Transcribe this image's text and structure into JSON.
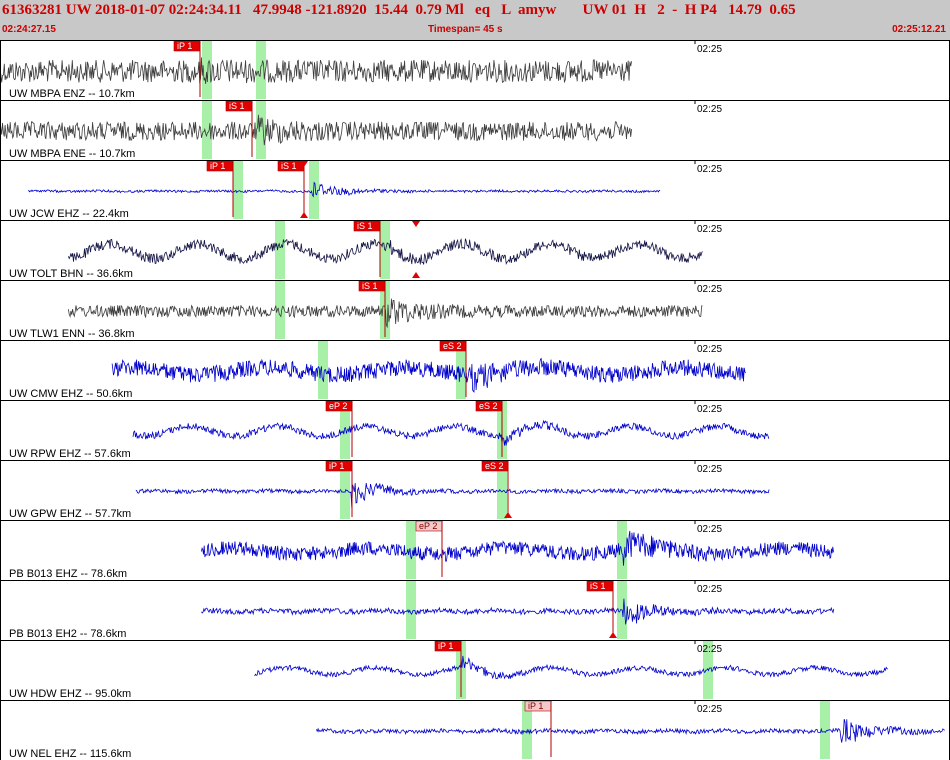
{
  "header": {
    "event_line": "61363281 UW 2018-01-07 02:24:34.11   47.9948 -121.8920  15.44  0.79 Ml   eq   L  amyw       UW 01  H   2  -  H P4   14.79  0.65",
    "start_time": "02:24:27.15",
    "timespan": "Timespan=  45 s",
    "end_time": "02:25:12.21"
  },
  "colors": {
    "header_bg": "#c8c8c8",
    "header_text": "#cc0000",
    "trace_gray": "#3c3c3c",
    "trace_blue": "#0000cc",
    "pick_fill": "#e00000",
    "pick_fill_light": "#f4c8c8",
    "window_green": "#a8f0a8",
    "border": "#000000"
  },
  "tick_label": "02:25",
  "channels": [
    {
      "label": "UW MBPA ENZ -- 10.7km",
      "color": "gray",
      "style": "noise",
      "start": 0.0,
      "end": 0.665,
      "amp": 0.42,
      "arrival": 0.21,
      "boost": 1.3,
      "picks": [
        {
          "text": "iP 1",
          "x": 0.21,
          "weight": "full",
          "marker": "none"
        }
      ],
      "windows": [
        0.218,
        0.275
      ]
    },
    {
      "label": "UW MBPA ENE -- 10.7km",
      "color": "gray",
      "style": "noise",
      "start": 0.0,
      "end": 0.665,
      "amp": 0.35,
      "arrival": 0.27,
      "boost": 1.8,
      "picks": [
        {
          "text": "iS 1",
          "x": 0.265,
          "weight": "full",
          "marker": "none"
        }
      ],
      "windows": [
        0.218,
        0.275
      ]
    },
    {
      "label": "UW JCW EHZ -- 22.4km",
      "color": "blue",
      "style": "quiet",
      "start": 0.03,
      "end": 0.695,
      "amp": 0.06,
      "arrival": 0.325,
      "boost": 9.0,
      "picks": [
        {
          "text": "iP 1",
          "x": 0.245,
          "weight": "full",
          "marker": "none"
        },
        {
          "text": "iS 1",
          "x": 0.32,
          "weight": "full",
          "marker": "tri"
        }
      ],
      "windows": [
        0.25,
        0.33
      ]
    },
    {
      "label": "UW TOLT BHN -- 36.6km",
      "color": "dark",
      "style": "wave",
      "start": 0.072,
      "end": 0.74,
      "amp": 0.42,
      "arrival": 0.405,
      "boost": 1.5,
      "picks": [
        {
          "text": "iS 1",
          "x": 0.4,
          "weight": "full",
          "marker": "tri2"
        }
      ],
      "windows": [
        0.295,
        0.405
      ]
    },
    {
      "label": "UW TLW1 ENN -- 36.8km",
      "color": "gray",
      "style": "noise",
      "start": 0.072,
      "end": 0.74,
      "amp": 0.22,
      "arrival": 0.405,
      "boost": 3.0,
      "picks": [
        {
          "text": "iS 1",
          "x": 0.405,
          "weight": "full",
          "marker": "none"
        }
      ],
      "windows": [
        0.295,
        0.405
      ]
    },
    {
      "label": "UW CMW EHZ -- 50.6km",
      "color": "blue",
      "style": "dense",
      "start": 0.118,
      "end": 0.785,
      "amp": 0.38,
      "arrival": 0.495,
      "boost": 1.9,
      "picks": [
        {
          "text": "eS 2",
          "x": 0.49,
          "weight": "full",
          "marker": "none"
        }
      ],
      "windows": [
        0.34,
        0.485
      ]
    },
    {
      "label": "UW RPW EHZ -- 57.6km",
      "color": "blue",
      "style": "wave",
      "start": 0.14,
      "end": 0.81,
      "amp": 0.28,
      "arrival": 0.528,
      "boost": 2.2,
      "picks": [
        {
          "text": "eP 2",
          "x": 0.37,
          "weight": "full",
          "marker": "none"
        },
        {
          "text": "eS 2",
          "x": 0.528,
          "weight": "full",
          "marker": "none"
        }
      ],
      "windows": [
        0.363,
        0.528
      ]
    },
    {
      "label": "UW GPW EHZ -- 57.7km",
      "color": "blue",
      "style": "quiet",
      "start": 0.143,
      "end": 0.81,
      "amp": 0.1,
      "arrival": 0.37,
      "boost": 7.0,
      "picks": [
        {
          "text": "iP 1",
          "x": 0.37,
          "weight": "full",
          "marker": "none"
        },
        {
          "text": "eS 2",
          "x": 0.535,
          "weight": "full",
          "marker": "tri"
        }
      ],
      "windows": [
        0.363,
        0.528
      ]
    },
    {
      "label": "PB B013 EHZ -- 78.6km",
      "color": "blue",
      "style": "dense",
      "start": 0.212,
      "end": 0.878,
      "amp": 0.33,
      "arrival": 0.655,
      "boost": 2.7,
      "picks": [
        {
          "text": "eP 2",
          "x": 0.465,
          "weight": "light",
          "marker": "none"
        }
      ],
      "windows": [
        0.433,
        0.655
      ]
    },
    {
      "label": "PB B013 EH2 -- 78.6km",
      "color": "blue",
      "style": "quiet",
      "start": 0.212,
      "end": 0.878,
      "amp": 0.14,
      "arrival": 0.655,
      "boost": 5.5,
      "picks": [
        {
          "text": "iS 1",
          "x": 0.645,
          "weight": "full",
          "marker": "tri"
        }
      ],
      "windows": [
        0.433,
        0.655
      ]
    },
    {
      "label": "UW HDW EHZ -- 95.0km",
      "color": "blue",
      "style": "wave",
      "start": 0.268,
      "end": 0.935,
      "amp": 0.2,
      "arrival": 0.485,
      "boost": 3.2,
      "picks": [
        {
          "text": "iP 1",
          "x": 0.485,
          "weight": "full",
          "marker": "none"
        }
      ],
      "windows": [
        0.485,
        0.745
      ]
    },
    {
      "label": "UW NEL EHZ -- 115.6km",
      "color": "blue",
      "style": "quiet",
      "start": 0.333,
      "end": 0.995,
      "amp": 0.11,
      "arrival": 0.885,
      "boost": 7.0,
      "picks": [
        {
          "text": "iP 1",
          "x": 0.58,
          "weight": "light",
          "marker": "none"
        }
      ],
      "windows": [
        0.555,
        0.868
      ]
    }
  ]
}
